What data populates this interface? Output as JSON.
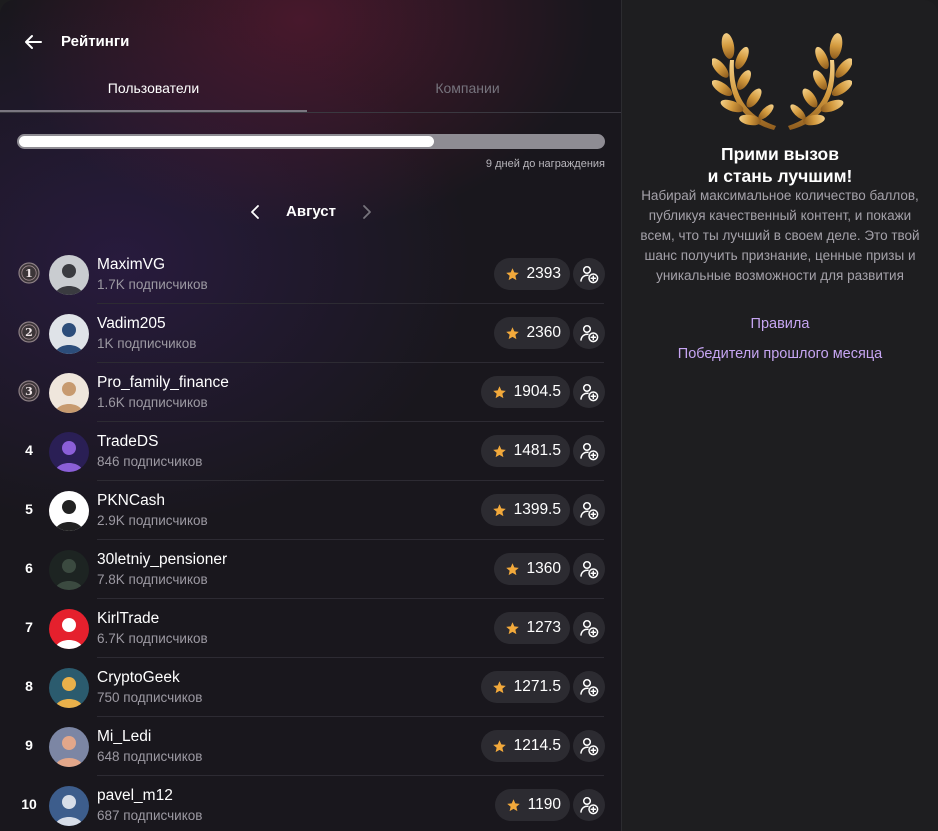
{
  "header": {
    "title": "Рейтинги"
  },
  "tabs": [
    {
      "label": "Пользователи",
      "active": true
    },
    {
      "label": "Компании",
      "active": false
    }
  ],
  "progress": {
    "fraction": 0.71,
    "label": "9 дней до награждения"
  },
  "month": {
    "label": "Август"
  },
  "users": [
    {
      "rank": "1",
      "medal": true,
      "name": "MaximVG",
      "subscribers": "1.7K подписчиков",
      "score": "2393",
      "avatar_color": "#c9ccd0",
      "avatar_accent": "#3a3b40"
    },
    {
      "rank": "2",
      "medal": true,
      "name": "Vadim205",
      "subscribers": "1K подписчиков",
      "score": "2360",
      "avatar_color": "#dfe3e8",
      "avatar_accent": "#2c4d7a"
    },
    {
      "rank": "3",
      "medal": true,
      "name": "Pro_family_finance",
      "subscribers": "1.6K подписчиков",
      "score": "1904.5",
      "avatar_color": "#efe6dc",
      "avatar_accent": "#c79a6f"
    },
    {
      "rank": "4",
      "medal": false,
      "name": "TradeDS",
      "subscribers": "846 подписчиков",
      "score": "1481.5",
      "avatar_color": "#2a1f55",
      "avatar_accent": "#8b5fd8"
    },
    {
      "rank": "5",
      "medal": false,
      "name": "PKNCash",
      "subscribers": "2.9K подписчиков",
      "score": "1399.5",
      "avatar_color": "#ffffff",
      "avatar_accent": "#222222"
    },
    {
      "rank": "6",
      "medal": false,
      "name": "30letniy_pensioner",
      "subscribers": "7.8K подписчиков",
      "score": "1360",
      "avatar_color": "#1d2422",
      "avatar_accent": "#3b4a40"
    },
    {
      "rank": "7",
      "medal": false,
      "name": "KirlTrade",
      "subscribers": "6.7K подписчиков",
      "score": "1273",
      "avatar_color": "#e5202d",
      "avatar_accent": "#ffffff"
    },
    {
      "rank": "8",
      "medal": false,
      "name": "CryptoGeek",
      "subscribers": "750 подписчиков",
      "score": "1271.5",
      "avatar_color": "#2b5b6e",
      "avatar_accent": "#e9b04a"
    },
    {
      "rank": "9",
      "medal": false,
      "name": "Mi_Ledi",
      "subscribers": "648 подписчиков",
      "score": "1214.5",
      "avatar_color": "#7c86a4",
      "avatar_accent": "#e3a78a"
    },
    {
      "rank": "10",
      "medal": false,
      "name": "pavel_m12",
      "subscribers": "687 подписчиков",
      "score": "1190",
      "avatar_color": "#3d5d8c",
      "avatar_accent": "#d7dde8"
    }
  ],
  "promo": {
    "title_line1": "Прими вызов",
    "title_line2": "и стань лучшим!",
    "text": "Набирай максимальное количество баллов, публикуя качественный контент, и покажи всем, что ты лучший в своем деле. Это твой шанс получить признание, ценные призы и уникальные возможности для развития",
    "rules_link": "Правила",
    "winners_link": "Победители прошлого месяца"
  },
  "icons": {
    "back": "arrow-left-icon",
    "prev": "chevron-left-icon",
    "next": "chevron-right-icon",
    "star": "star-icon",
    "follow": "add-user-icon",
    "laurel": "laurel-wreath-icon"
  },
  "colors": {
    "accent_link": "#c6a5f2",
    "star": "#f2a93b",
    "laurel_gold": "#d9a54a"
  }
}
